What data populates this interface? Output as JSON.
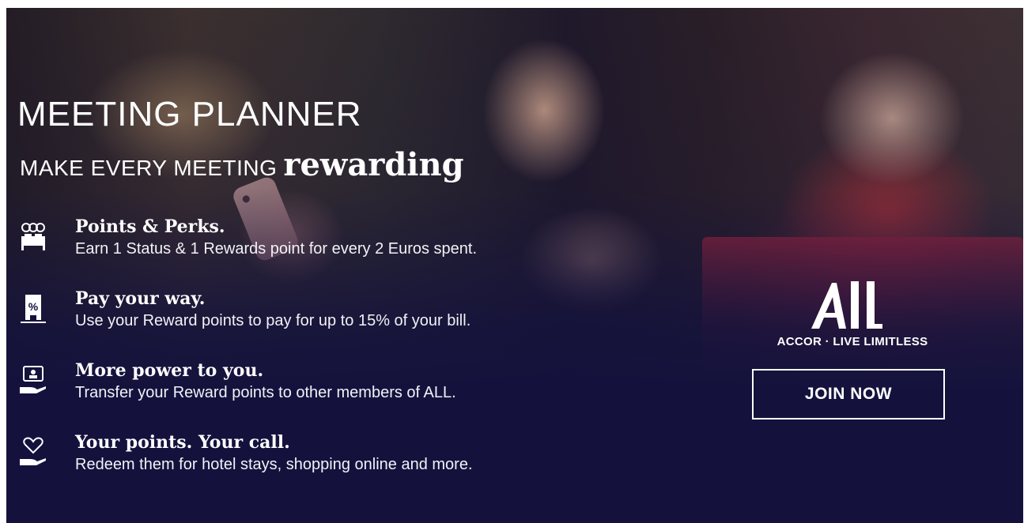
{
  "title": "MEETING PLANNER",
  "tagline": {
    "prefix": "MAKE EVERY MEETING",
    "emphasis": "rewarding"
  },
  "benefits": [
    {
      "icon": "bed-icon",
      "heading": "Points & Perks.",
      "description": "Earn 1 Status & 1 Rewards point for every 2 Euros spent."
    },
    {
      "icon": "percent-tag-icon",
      "heading": "Pay your way.",
      "description": "Use your Reward points to pay for up to 15% of your bill."
    },
    {
      "icon": "hand-card-icon",
      "heading": "More power to you.",
      "description": "Transfer your Reward points to other members of ALL."
    },
    {
      "icon": "hand-heart-icon",
      "heading": "Your points. Your call.",
      "description": "Redeem them for hotel stays, shopping online and more."
    }
  ],
  "brand": {
    "mark": "All",
    "line": "ACCOR · LIVE LIMITLESS"
  },
  "cta": {
    "label": "JOIN NOW"
  },
  "colors": {
    "background": "#14123d",
    "text": "#ffffff"
  }
}
